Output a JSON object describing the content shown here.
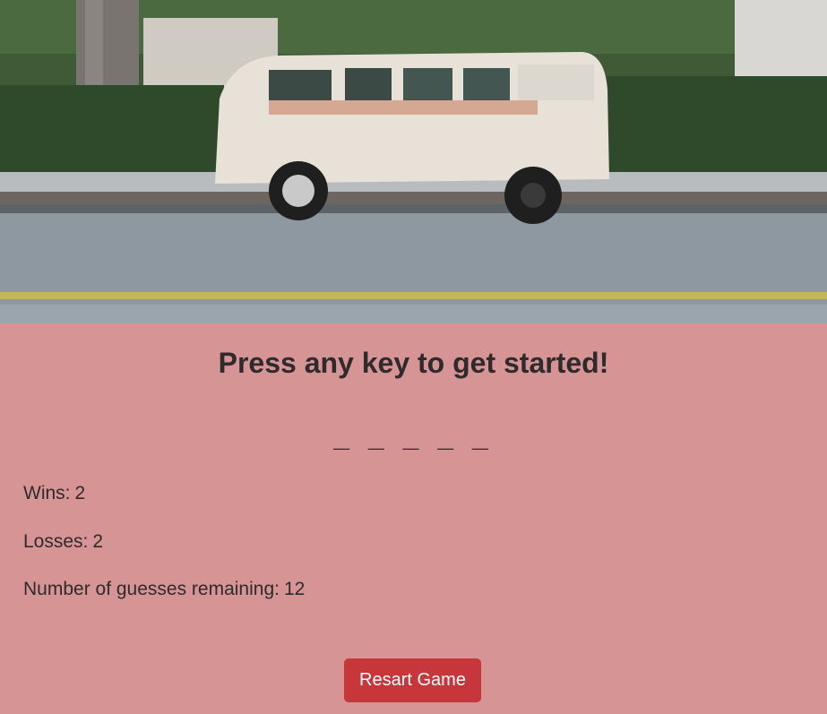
{
  "hero": {
    "image": "vintage-van-photo",
    "colors": {
      "sky": "#3f5a35",
      "road": "#8d98a0",
      "van": "#e7e1d8",
      "line": "#c8b45a"
    }
  },
  "game": {
    "prompt": "Press any key to get started!",
    "blanks": "_ _ _ _ _",
    "wins_label": "Wins:",
    "wins": "2",
    "losses_label": "Losses:",
    "losses": "2",
    "guesses_label": "Number of guesses remaining:",
    "guesses": "12",
    "restart_label": "Resart Game"
  },
  "colors": {
    "panel_bg": "#d69494",
    "button_bg": "#c7363a",
    "text": "#2f2a2c"
  }
}
